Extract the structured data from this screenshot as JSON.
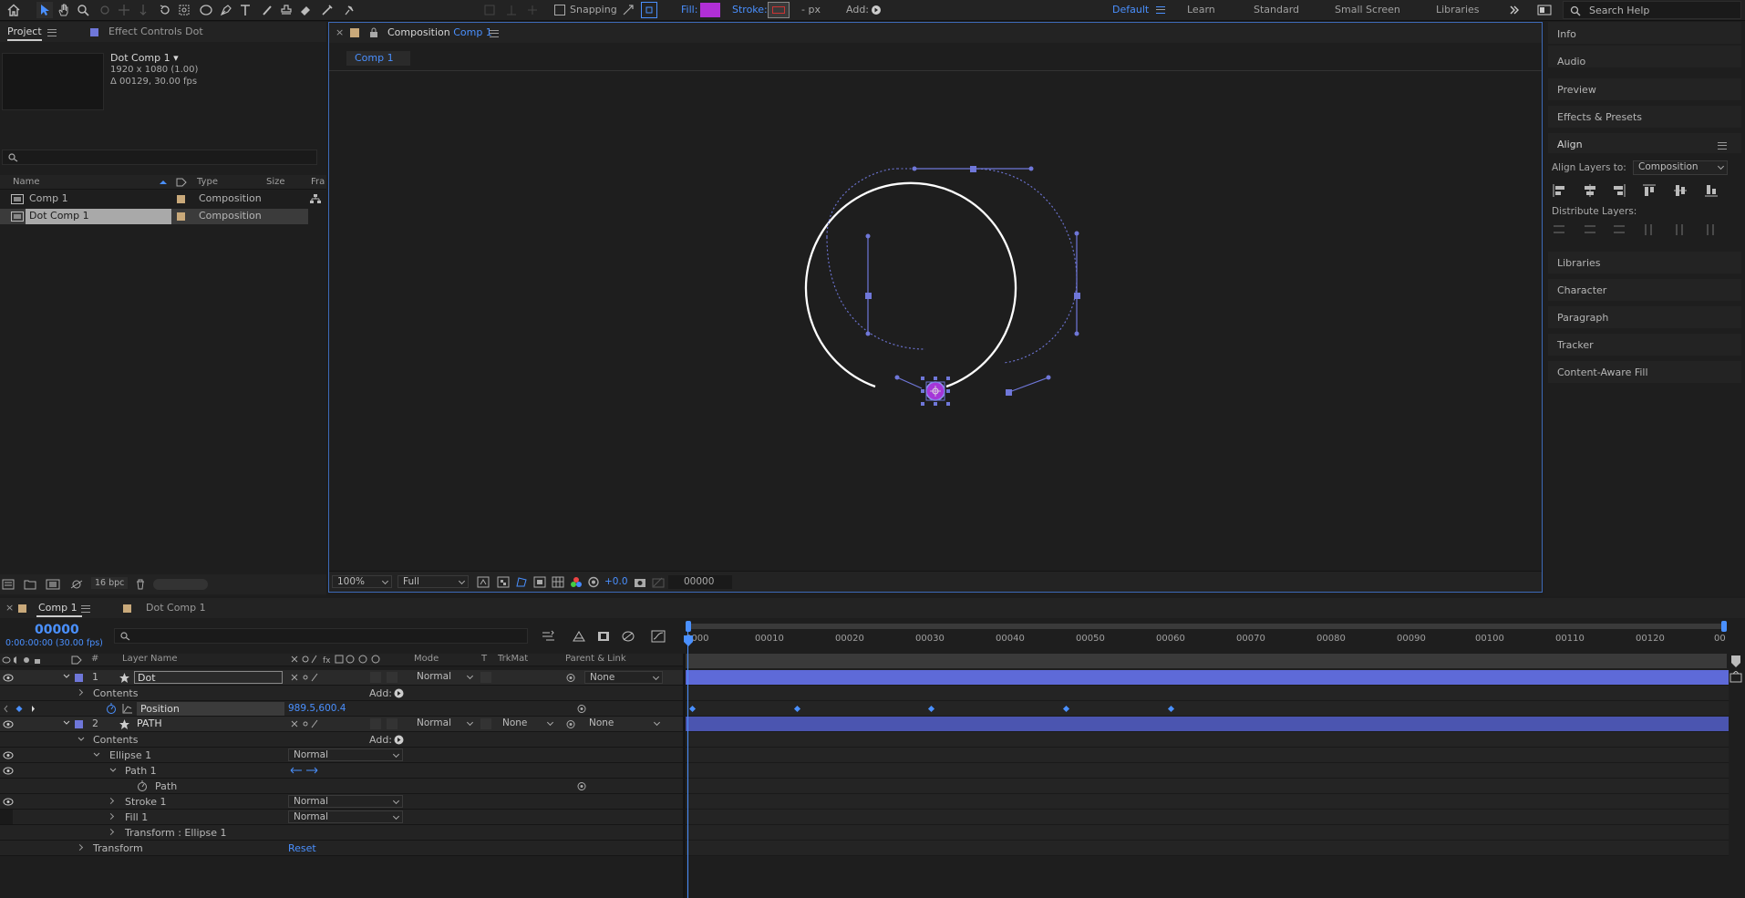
{
  "toolbar": {
    "snapping": "Snapping",
    "fill_label": "Fill:",
    "fill_color": "#b12fd6",
    "stroke_label": "Stroke:",
    "stroke_px": "- px",
    "add_label": "Add:",
    "workspaces": [
      "Default",
      "Learn",
      "Standard",
      "Small Screen",
      "Libraries"
    ],
    "search_placeholder": "Search Help",
    "accent": "#4a90ff"
  },
  "project": {
    "tab_project": "Project",
    "tab_effect_controls": "Effect Controls",
    "effect_controls_layer": "Dot",
    "item_name": "Dot Comp 1 ▾",
    "item_size": "1920 x 1080 (1.00)",
    "item_duration": "Δ 00129, 30.00 fps",
    "columns": {
      "name": "Name",
      "type": "Type",
      "size": "Size",
      "fra": "Fra"
    },
    "items": [
      {
        "name": "Comp 1",
        "type": "Composition"
      },
      {
        "name": "Dot Comp 1",
        "type": "Composition"
      }
    ],
    "bpc": "16 bpc"
  },
  "composition": {
    "tab_prefix": "Composition",
    "tab_name": "Comp 1",
    "sub_tab": "Comp 1",
    "zoom": "100%",
    "resolution": "Full",
    "exposure": "+0.0",
    "timecode": "00000"
  },
  "right_panels": {
    "items_top": [
      "Info",
      "Audio",
      "Preview",
      "Effects & Presets"
    ],
    "align_title": "Align",
    "align_layers_to_label": "Align Layers to:",
    "align_layers_to_value": "Composition",
    "distribute_label": "Distribute Layers:",
    "items_bottom": [
      "Libraries",
      "Character",
      "Paragraph",
      "Tracker",
      "Content-Aware Fill"
    ]
  },
  "timeline": {
    "tabs": [
      "Comp 1",
      "Dot Comp 1"
    ],
    "current_time": "00000",
    "current_time_sub": "0:00:00:00 (30.00 fps)",
    "columns": {
      "layer_name": "Layer Name",
      "mode": "Mode",
      "t": "T",
      "trkmat": "TrkMat",
      "parent": "Parent & Link"
    },
    "ruler": [
      "0000",
      "00010",
      "00020",
      "00030",
      "00040",
      "00050",
      "00060",
      "00070",
      "00080",
      "00090",
      "00100",
      "00110",
      "00120",
      "00"
    ],
    "layers": {
      "dot_index": "1",
      "dot_name": "Dot",
      "dot_mode": "Normal",
      "dot_parent": "None",
      "contents": "Contents",
      "add": "Add:",
      "position_label": "Position",
      "position_value": "989.5,600.4",
      "path_index": "2",
      "path_name": "PATH",
      "path_mode": "Normal",
      "path_trkmat": "None",
      "path_parent": "None",
      "contents2": "Contents",
      "add2": "Add:",
      "ellipse1": "Ellipse 1",
      "ellipse1_mode": "Normal",
      "path1": "Path 1",
      "path": "Path",
      "stroke1": "Stroke 1",
      "stroke1_mode": "Normal",
      "fill1": "Fill 1",
      "fill1_mode": "Normal",
      "transform_ellipse": "Transform : Ellipse 1",
      "transform": "Transform",
      "reset": "Reset"
    }
  }
}
